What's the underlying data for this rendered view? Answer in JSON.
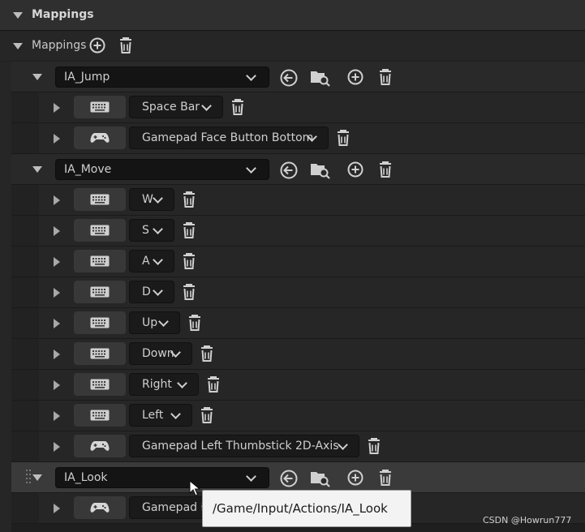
{
  "panel": {
    "section_title": "Mappings",
    "mappings_label": "Mappings"
  },
  "groups": [
    {
      "action": "IA_Jump",
      "keys": [
        "Space Bar",
        "Gamepad Face Button Bottom"
      ]
    },
    {
      "action": "IA_Move",
      "keys": [
        "W",
        "S",
        "A",
        "D",
        "Up",
        "Down",
        "Right",
        "Left",
        "Gamepad Left Thumbstick 2D-Axis"
      ]
    },
    {
      "action": "IA_Look",
      "keys": [
        "Gamepad R"
      ]
    }
  ],
  "tooltip": {
    "text": "/Game/Input/Actions/IA_Look"
  },
  "watermark": {
    "text": "CSDN @Howrun777"
  },
  "icons": {
    "keyboard": "keyboard-icon",
    "gamepad": "gamepad-icon",
    "add": "add-icon",
    "delete": "trash-icon",
    "use_selected": "use-selected-icon",
    "browse": "browse-folder-icon"
  }
}
